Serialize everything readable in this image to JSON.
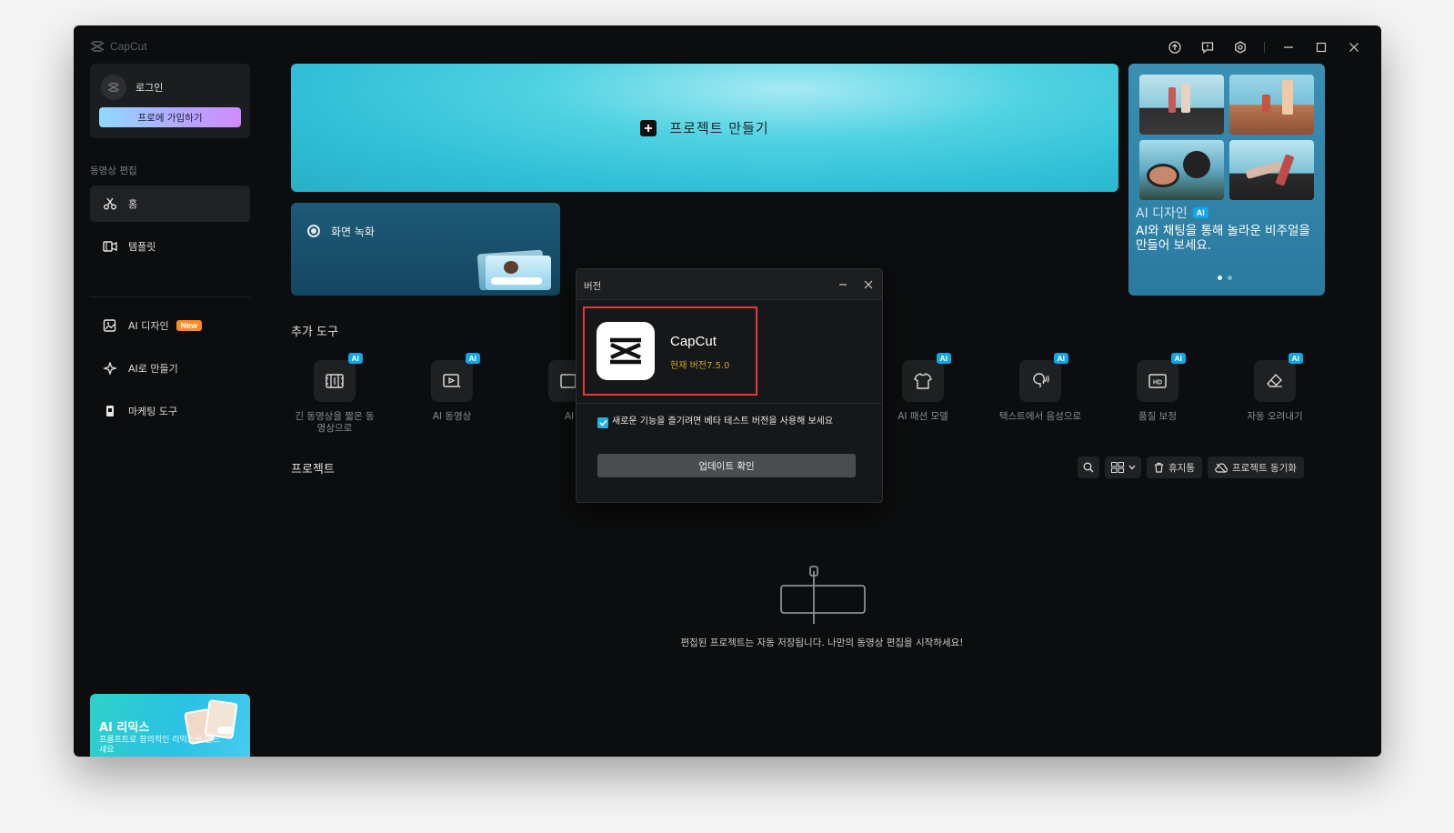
{
  "app": {
    "logo_text": "CapCut"
  },
  "sidebar": {
    "login_label": "로그인",
    "pro_button": "프로에 가입하기",
    "section_label": "동영상 편집",
    "items": [
      {
        "label": "홈",
        "icon": "scissors-icon"
      },
      {
        "label": "템플릿",
        "icon": "template-icon"
      },
      {
        "label": "AI 디자인",
        "badge": "New",
        "icon": "ai-design-icon"
      },
      {
        "label": "AI로 만들기",
        "icon": "sparkle-icon"
      },
      {
        "label": "마케팅 도구",
        "icon": "marketing-icon"
      }
    ],
    "remix": {
      "title": "AI 리믹스",
      "subtitle": "프롬프트로 창의적인 리믹스를 만드세요"
    }
  },
  "main": {
    "create_project": "프로젝트 만들기",
    "screen_record": "화면 녹화",
    "promo": {
      "title": "AI 디자인",
      "tag": "AI",
      "description": "AI와 채팅을 통해 놀라운 비주얼을 만들어 보세요."
    },
    "tools_title": "추가 도구",
    "tools": [
      {
        "label": "긴 동영상을 짧은 동영상으로",
        "tag": "AI",
        "icon": "film-split-icon"
      },
      {
        "label": "AI 동영상",
        "tag": "AI",
        "icon": "video-play-icon"
      },
      {
        "label": "AI",
        "tag": "",
        "icon": "ai-tool-icon"
      },
      {
        "label": "AI 패션 모델",
        "tag": "AI",
        "icon": "shirt-icon"
      },
      {
        "label": "텍스트에서 음성으로",
        "tag": "AI",
        "icon": "speaking-head-icon"
      },
      {
        "label": "품질 보정",
        "tag": "AI",
        "icon": "hd-icon"
      },
      {
        "label": "자동 오려내기",
        "tag": "AI",
        "icon": "eraser-icon"
      }
    ],
    "projects_title": "프로젝트",
    "trash_label": "휴지통",
    "sync_label": "프로젝트 동기화",
    "empty_text": "편집된 프로젝트는 자동 저장됩니다. 나만의 동영상 편집을 시작하세요!"
  },
  "dialog": {
    "title": "버전",
    "app_name": "CapCut",
    "current_version": "현재 버전7.5.0",
    "beta_label": "새로운 기능을 즐기려면 베타 테스트 버전을 사용해 보세요",
    "update_button": "업데이트 확인"
  },
  "colors": {
    "accent": "#1fb3e0",
    "highlight": "#e23a3a",
    "new_badge": "#ff8a1f"
  }
}
